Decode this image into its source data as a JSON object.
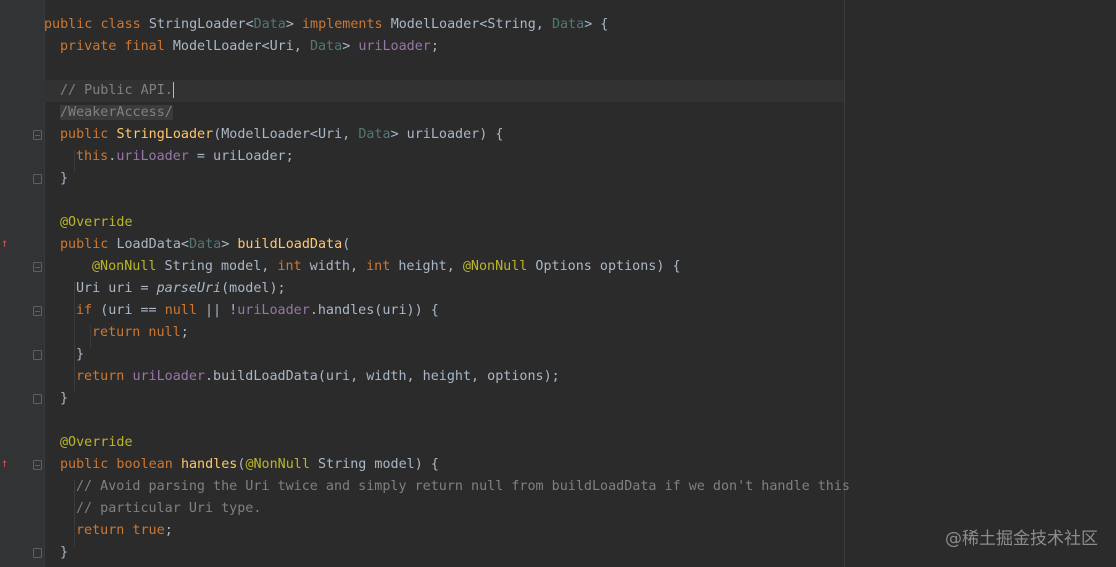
{
  "editor": {
    "lines": {
      "l1": {
        "kw1": "public ",
        "kw2": "class ",
        "cls": "StringLoader",
        "lt": "<",
        "gen": "Data",
        "gt": "> ",
        "kw3": "implements ",
        "iface": "ModelLoader<String, ",
        "gen2": "Data",
        "end": "> {"
      },
      "l2": {
        "kw": "private final ",
        "type": "ModelLoader<Uri, ",
        "gen": "Data",
        "gt": "> ",
        "fld": "uriLoader",
        "end": ";"
      },
      "l3": {
        "cmt": "// Public API."
      },
      "l4": {
        "cmt": "/WeakerAccess/"
      },
      "l5": {
        "kw": "public ",
        "mth": "StringLoader",
        "p1": "(ModelLoader<Uri, ",
        "gen": "Data",
        "p2": "> uriLoader) {"
      },
      "l6": {
        "kw": "this",
        "dot": ".",
        "fld": "uriLoader",
        "rest": " = uriLoader;"
      },
      "l7": {
        "text": "}"
      },
      "l8": {
        "ann": "@Override"
      },
      "l9": {
        "kw": "public ",
        "type": "LoadData<",
        "gen": "Data",
        "gt": "> ",
        "mth": "buildLoadData",
        "end": "("
      },
      "l10": {
        "ann1": "@NonNull",
        "t1": " String model, ",
        "kw1": "int",
        "t2": " width, ",
        "kw2": "int",
        "t3": " height, ",
        "ann2": "@NonNull",
        "t4": " Options options) {"
      },
      "l11": {
        "t1": "Uri uri = ",
        "ital": "parseUri",
        "t2": "(model);"
      },
      "l12": {
        "kw1": "if ",
        "t1": "(uri == ",
        "kw2": "null",
        "t2": " || !",
        "fld": "uriLoader",
        "t3": ".handles(uri)) {"
      },
      "l13": {
        "kw": "return null",
        "t": ";"
      },
      "l14": {
        "text": "}"
      },
      "l15": {
        "kw": "return ",
        "fld": "uriLoader",
        "t": ".buildLoadData(uri, width, height, options);"
      },
      "l16": {
        "text": "}"
      },
      "l17": {
        "ann": "@Override"
      },
      "l18": {
        "kw": "public boolean ",
        "mth": "handles",
        "t1": "(",
        "ann": "@NonNull",
        "t2": " String model) {"
      },
      "l19": {
        "cmt": "// Avoid parsing the Uri twice and simply return null from buildLoadData if we don't handle this"
      },
      "l20": {
        "cmt": "// particular Uri type."
      },
      "l21": {
        "kw": "return true",
        "t": ";"
      },
      "l22": {
        "text": "}"
      }
    }
  },
  "watermark": "@稀土掘金技术社区",
  "colors": {
    "background": "#2b2b2b",
    "keyword": "#cc7832",
    "generic": "#507874",
    "field": "#9876aa",
    "method": "#ffc66d",
    "annotation": "#bbb529",
    "comment": "#808080"
  },
  "icons": [
    "fold-marker-icon",
    "override-arrow-icon"
  ]
}
